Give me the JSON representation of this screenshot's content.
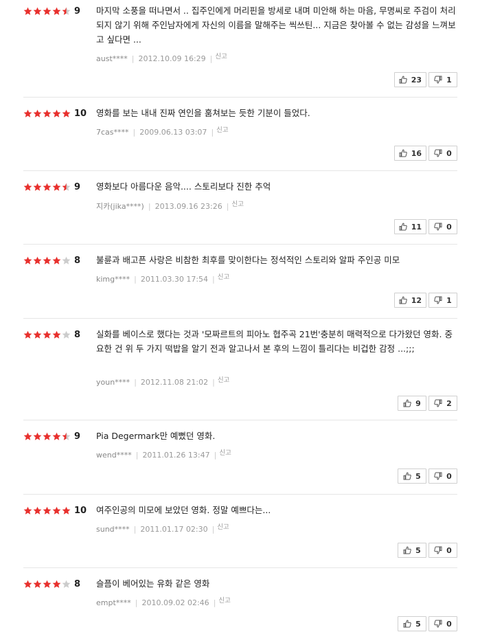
{
  "star_color": "#e8302d",
  "star_empty_color": "#cccccc",
  "report_label": "신고",
  "reviews": [
    {
      "stars": 4.5,
      "score": "9",
      "text": "마지막 소풍을 떠나면서 .. 집주인에게 머리핀을 방세로 내며 미안해 하는 마음, 무명씨로 주검이 처리 되지 않기 위해 주인남자에게 자신의 이름을 말해주는 씩쓰틴... 지금은 찾아볼 수 없는 감성을 느껴보고 싶다면 ...",
      "user": "aust****",
      "date": "2012.10.09 16:29",
      "up": "23",
      "down": "1"
    },
    {
      "stars": 5,
      "score": "10",
      "text": "영화를 보는 내내 진짜 연인을 훔쳐보는 듯한 기분이 들었다.",
      "user": "7cas****",
      "date": "2009.06.13 03:07",
      "up": "16",
      "down": "0"
    },
    {
      "stars": 4.5,
      "score": "9",
      "text": "영화보다 아름다운 음악.... 스토리보다 진한 추억",
      "user": "지카(jika****)",
      "date": "2013.09.16 23:26",
      "up": "11",
      "down": "0"
    },
    {
      "stars": 4,
      "score": "8",
      "text": "불륜과 배고픈 사랑은 비참한 최후를 맞이한다는 정석적인 스토리와 알파 주인공 미모",
      "user": "kimg****",
      "date": "2011.03.30 17:54",
      "up": "12",
      "down": "1"
    },
    {
      "stars": 4,
      "score": "8",
      "text": "실화를 베이스로 했다는 것과 '모짜르트의 피아노 협주곡 21번'충분히 매력적으로 다가왔던 영화. 중요한 건 위 두 가지 떡밥을 알기 전과 알고나서 본 후의 느낌이 틀리다는 비겁한 감정 ...;;;",
      "user": "youn****",
      "date": "2012.11.08 21:02",
      "up": "9",
      "down": "2"
    },
    {
      "stars": 4.5,
      "score": "9",
      "text": "Pia Degermark만 예뻤던 영화.",
      "user": "wend****",
      "date": "2011.01.26 13:47",
      "up": "5",
      "down": "0"
    },
    {
      "stars": 5,
      "score": "10",
      "text": "여주인공의 미모에 보았던 영화. 정말 예쁘다는...",
      "user": "sund****",
      "date": "2011.01.17 02:30",
      "up": "5",
      "down": "0"
    },
    {
      "stars": 4,
      "score": "8",
      "text": "슬픔이 베어있는 유화 같은 영화",
      "user": "empt****",
      "date": "2010.09.02 02:46",
      "up": "5",
      "down": "0"
    }
  ]
}
